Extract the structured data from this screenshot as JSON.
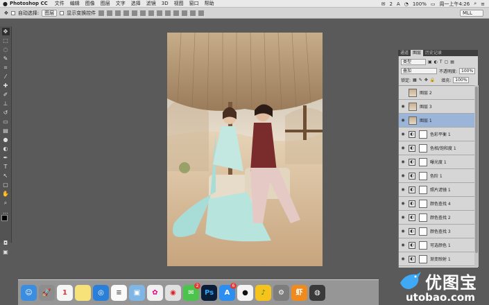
{
  "menubar": {
    "app_name": "Photoshop CC",
    "items": [
      "文件",
      "编辑",
      "图像",
      "图层",
      "文字",
      "选择",
      "滤镜",
      "3D",
      "视图",
      "窗口",
      "帮助"
    ],
    "status": {
      "wechat_badge": "2",
      "battery": "100%",
      "datetime": "周一上午4:26"
    }
  },
  "options": {
    "auto_select_label": "自动选择:",
    "auto_select_value": "图层",
    "show_transform_label": "显示变换控件",
    "workspace": "MLL"
  },
  "panel": {
    "tabs": [
      "通道",
      "图层",
      "历史记录"
    ],
    "filter_type": "类型",
    "blend_mode": "叠加",
    "opacity_label": "不透明度:",
    "opacity_value": "100%",
    "lock_label": "锁定:",
    "fill_label": "填充:",
    "fill_value": "100%",
    "layers": [
      {
        "name": "图层 2",
        "kind": "pixel",
        "visible": false,
        "selected": false
      },
      {
        "name": "图层 3",
        "kind": "pixel",
        "visible": true,
        "selected": false
      },
      {
        "name": "图层 1",
        "kind": "pixel",
        "visible": true,
        "selected": true
      },
      {
        "name": "色彩平衡 1",
        "kind": "adjust",
        "visible": true,
        "selected": false
      },
      {
        "name": "色相/饱和度 1",
        "kind": "adjust",
        "visible": true,
        "selected": false
      },
      {
        "name": "曝光度 1",
        "kind": "adjust",
        "visible": true,
        "selected": false
      },
      {
        "name": "色阶 1",
        "kind": "adjust",
        "visible": true,
        "selected": false
      },
      {
        "name": "照片滤镜 1",
        "kind": "adjust",
        "visible": true,
        "selected": false
      },
      {
        "name": "颜色查找 4",
        "kind": "adjust",
        "visible": true,
        "selected": false
      },
      {
        "name": "颜色查找 2",
        "kind": "adjust",
        "visible": true,
        "selected": false
      },
      {
        "name": "颜色查找 3",
        "kind": "adjust",
        "visible": true,
        "selected": false
      },
      {
        "name": "可选颜色 1",
        "kind": "adjust",
        "visible": true,
        "selected": false
      },
      {
        "name": "渐变映射 1",
        "kind": "adjust",
        "visible": true,
        "selected": false
      }
    ]
  },
  "dock": {
    "apps": [
      {
        "name": "finder",
        "glyph": "☺",
        "color": "#3b8de0"
      },
      {
        "name": "launchpad",
        "glyph": "🚀",
        "color": "#8d8d8d"
      },
      {
        "name": "calendar",
        "glyph": "1",
        "color": "#f5f5f5",
        "fg": "#d33"
      },
      {
        "name": "notes",
        "glyph": "",
        "color": "#f7e27a"
      },
      {
        "name": "safari",
        "glyph": "◎",
        "color": "#2a7fd9"
      },
      {
        "name": "reminders",
        "glyph": "≡",
        "color": "#fafafa",
        "fg": "#555"
      },
      {
        "name": "preview",
        "glyph": "▣",
        "color": "#7fb6e6"
      },
      {
        "name": "photos",
        "glyph": "✿",
        "color": "#f0f0f0",
        "fg": "#e08"
      },
      {
        "name": "weibo",
        "glyph": "◉",
        "color": "#e0e0e0",
        "fg": "#d22"
      },
      {
        "name": "wechat",
        "glyph": "✉",
        "color": "#4cc34c",
        "badge": "2"
      },
      {
        "name": "photoshop",
        "glyph": "Ps",
        "color": "#0b1e38",
        "fg": "#31a8ff"
      },
      {
        "name": "appstore",
        "glyph": "A",
        "color": "#2b8ef0",
        "badge": "6"
      },
      {
        "name": "qq",
        "glyph": "●",
        "color": "#f4f4f4",
        "fg": "#111"
      },
      {
        "name": "qqmusic",
        "glyph": "♪",
        "color": "#f6c31c",
        "fg": "#2a8a2a"
      },
      {
        "name": "preferences",
        "glyph": "⚙",
        "color": "#7d7d7d"
      },
      {
        "name": "xiami",
        "glyph": "虾",
        "color": "#f08a1d"
      },
      {
        "name": "camera",
        "glyph": "◍",
        "color": "#3a3a3a"
      }
    ]
  },
  "watermark": {
    "cn": "优图宝",
    "url": "utobao.com"
  }
}
